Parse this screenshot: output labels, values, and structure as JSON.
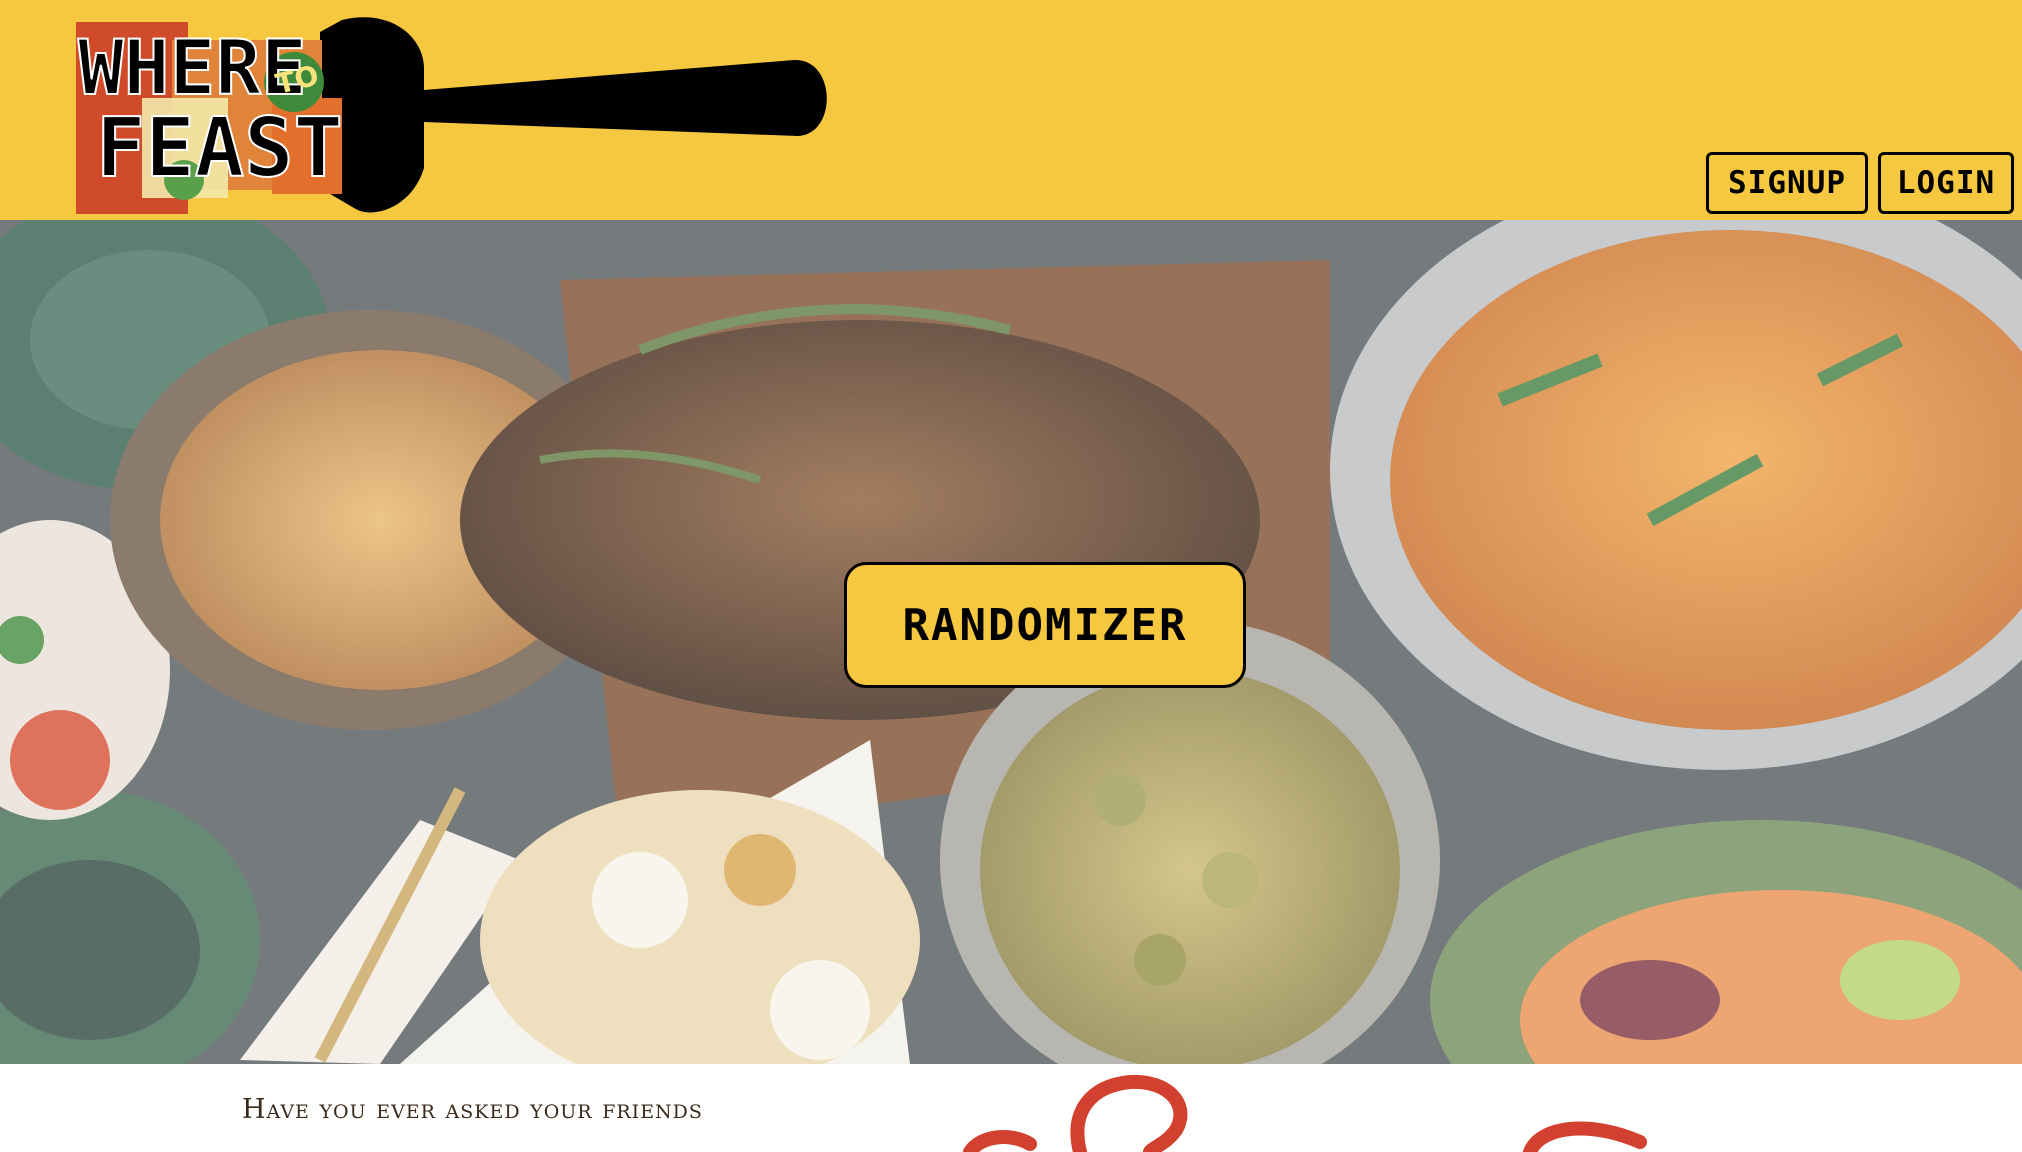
{
  "header": {
    "logo": {
      "line1": "WHERE",
      "small": "TO",
      "line2": "FEAST"
    },
    "nav": {
      "signup_label": "SIGNUP",
      "login_label": "LOGIN"
    }
  },
  "hero": {
    "button_label": "RANDOMIZER"
  },
  "intro": {
    "text": "Have you ever asked your friends"
  },
  "colors": {
    "brand_yellow": "#f6c83f",
    "ink": "#000000",
    "accent_red": "#d2402f",
    "accent_green": "#3f8a3a"
  },
  "icons": {
    "logo_fork": "fork-icon",
    "question_art": "question-mark-icon"
  }
}
